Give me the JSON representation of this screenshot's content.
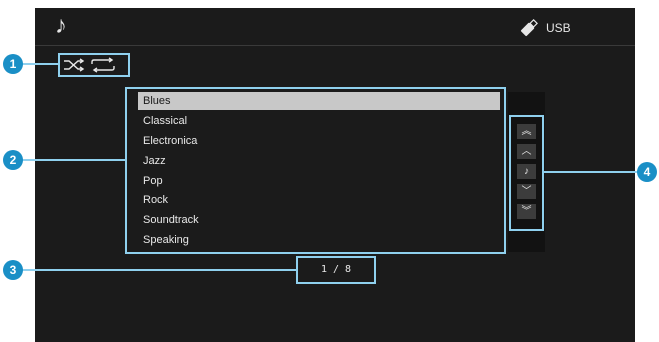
{
  "header": {
    "source_icon": "music-note-icon",
    "device_icon": "usb-stick-icon",
    "device_label": "USB"
  },
  "playback_modes": {
    "shuffle_icon": "shuffle-icon",
    "repeat_icon": "repeat-icon"
  },
  "list": {
    "items": [
      "Blues",
      "Classical",
      "Electronica",
      "Jazz",
      "Pop",
      "Rock",
      "Soundtrack",
      "Speaking"
    ],
    "selected": "Blues"
  },
  "pagination": {
    "text": "1 / 8"
  },
  "nav": {
    "buttons": [
      "page-up-icon",
      "up-icon",
      "now-playing-icon",
      "down-icon",
      "page-down-icon"
    ]
  },
  "callouts": [
    "1",
    "2",
    "3",
    "4"
  ],
  "colors": {
    "screen_bg": "#1b1b1b",
    "highlight": "#8fd0ee",
    "callout": "#1a8fc6",
    "selected_bg": "#c8c8c8"
  }
}
